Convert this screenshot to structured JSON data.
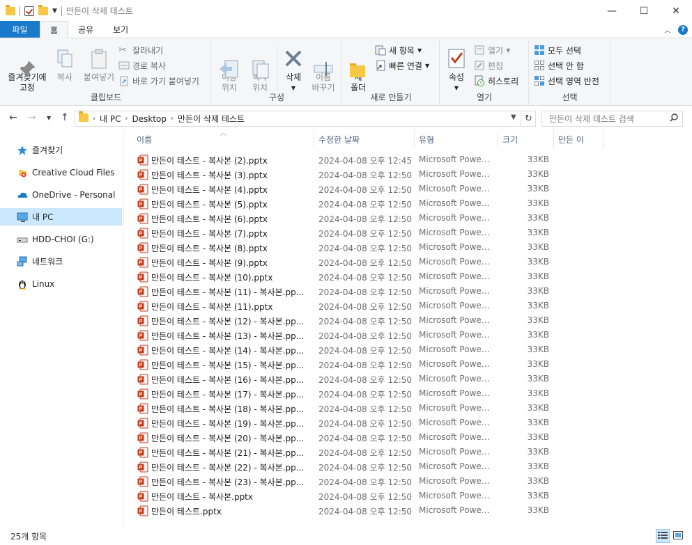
{
  "window": {
    "title": "만든이 삭제 테스트",
    "controls": {
      "minimize": "—",
      "maximize": "☐",
      "close": "✕"
    }
  },
  "ribbon_tabs": [
    "파일",
    "홈",
    "공유",
    "보기"
  ],
  "ribbon": {
    "clipboard": {
      "label": "클립보드",
      "pin": "즐겨찾기에\n고정",
      "copy": "복사",
      "paste": "붙여넣기",
      "cut": "잘라내기",
      "copy_path": "경로 복사",
      "paste_shortcut": "바로 가기 붙여넣기"
    },
    "organize": {
      "label": "구성",
      "move_to": "이동\n위치",
      "copy_to": "복사\n위치",
      "delete": "삭제",
      "rename": "이름\n바꾸기"
    },
    "new": {
      "label": "새로 만들기",
      "new_folder": "새\n폴더",
      "new_item": "새 항목",
      "easy_access": "빠른 연결"
    },
    "open": {
      "label": "열기",
      "properties": "속성",
      "open": "열기",
      "edit": "편집",
      "history": "히스토리"
    },
    "select": {
      "label": "선택",
      "select_all": "모두 선택",
      "select_none": "선택 안 함",
      "invert": "선택 영역 반전"
    }
  },
  "address": {
    "crumbs": [
      "내 PC",
      "Desktop",
      "만든이 삭제 테스트"
    ],
    "search_placeholder": "만든이 삭제 테스트 검색"
  },
  "navpane": {
    "items": [
      {
        "label": "즐겨찾기",
        "icon": "star-icon"
      },
      {
        "label": "Creative Cloud Files",
        "icon": "creative-cloud-icon"
      },
      {
        "label": "OneDrive - Personal",
        "icon": "onedrive-icon"
      },
      {
        "label": "내 PC",
        "icon": "pc-icon",
        "selected": true
      },
      {
        "label": "HDD-CHOI (G:)",
        "icon": "drive-icon"
      },
      {
        "label": "네트워크",
        "icon": "network-icon"
      },
      {
        "label": "Linux",
        "icon": "linux-icon"
      }
    ]
  },
  "columns": [
    "이름",
    "수정한 날짜",
    "유형",
    "크기",
    "만든 이"
  ],
  "files": [
    {
      "name": "만든이 테스트 - 복사본 (2).pptx",
      "date": "2024-04-08 오후 12:45",
      "type": "Microsoft PowerP...",
      "size": "33KB"
    },
    {
      "name": "만든이 테스트 - 복사본 (3).pptx",
      "date": "2024-04-08 오후 12:50",
      "type": "Microsoft PowerP...",
      "size": "33KB"
    },
    {
      "name": "만든이 테스트 - 복사본 (4).pptx",
      "date": "2024-04-08 오후 12:50",
      "type": "Microsoft PowerP...",
      "size": "33KB"
    },
    {
      "name": "만든이 테스트 - 복사본 (5).pptx",
      "date": "2024-04-08 오후 12:50",
      "type": "Microsoft PowerP...",
      "size": "33KB"
    },
    {
      "name": "만든이 테스트 - 복사본 (6).pptx",
      "date": "2024-04-08 오후 12:50",
      "type": "Microsoft PowerP...",
      "size": "33KB"
    },
    {
      "name": "만든이 테스트 - 복사본 (7).pptx",
      "date": "2024-04-08 오후 12:50",
      "type": "Microsoft PowerP...",
      "size": "33KB"
    },
    {
      "name": "만든이 테스트 - 복사본 (8).pptx",
      "date": "2024-04-08 오후 12:50",
      "type": "Microsoft PowerP...",
      "size": "33KB"
    },
    {
      "name": "만든이 테스트 - 복사본 (9).pptx",
      "date": "2024-04-08 오후 12:50",
      "type": "Microsoft PowerP...",
      "size": "33KB"
    },
    {
      "name": "만든이 테스트 - 복사본 (10).pptx",
      "date": "2024-04-08 오후 12:50",
      "type": "Microsoft PowerP...",
      "size": "33KB"
    },
    {
      "name": "만든이 테스트 - 복사본 (11) - 복사본.pp...",
      "date": "2024-04-08 오후 12:50",
      "type": "Microsoft PowerP...",
      "size": "33KB"
    },
    {
      "name": "만든이 테스트 - 복사본 (11).pptx",
      "date": "2024-04-08 오후 12:50",
      "type": "Microsoft PowerP...",
      "size": "33KB"
    },
    {
      "name": "만든이 테스트 - 복사본 (12) - 복사본.pp...",
      "date": "2024-04-08 오후 12:50",
      "type": "Microsoft PowerP...",
      "size": "33KB"
    },
    {
      "name": "만든이 테스트 - 복사본 (13) - 복사본.pp...",
      "date": "2024-04-08 오후 12:50",
      "type": "Microsoft PowerP...",
      "size": "33KB"
    },
    {
      "name": "만든이 테스트 - 복사본 (14) - 복사본.pp...",
      "date": "2024-04-08 오후 12:50",
      "type": "Microsoft PowerP...",
      "size": "33KB"
    },
    {
      "name": "만든이 테스트 - 복사본 (15) - 복사본.pp...",
      "date": "2024-04-08 오후 12:50",
      "type": "Microsoft PowerP...",
      "size": "33KB"
    },
    {
      "name": "만든이 테스트 - 복사본 (16) - 복사본.pp...",
      "date": "2024-04-08 오후 12:50",
      "type": "Microsoft PowerP...",
      "size": "33KB"
    },
    {
      "name": "만든이 테스트 - 복사본 (17) - 복사본.pp...",
      "date": "2024-04-08 오후 12:50",
      "type": "Microsoft PowerP...",
      "size": "33KB"
    },
    {
      "name": "만든이 테스트 - 복사본 (18) - 복사본.pp...",
      "date": "2024-04-08 오후 12:50",
      "type": "Microsoft PowerP...",
      "size": "33KB"
    },
    {
      "name": "만든이 테스트 - 복사본 (19) - 복사본.pp...",
      "date": "2024-04-08 오후 12:50",
      "type": "Microsoft PowerP...",
      "size": "33KB"
    },
    {
      "name": "만든이 테스트 - 복사본 (20) - 복사본.pp...",
      "date": "2024-04-08 오후 12:50",
      "type": "Microsoft PowerP...",
      "size": "33KB"
    },
    {
      "name": "만든이 테스트 - 복사본 (21) - 복사본.pp...",
      "date": "2024-04-08 오후 12:50",
      "type": "Microsoft PowerP...",
      "size": "33KB"
    },
    {
      "name": "만든이 테스트 - 복사본 (22) - 복사본.pp...",
      "date": "2024-04-08 오후 12:50",
      "type": "Microsoft PowerP...",
      "size": "33KB"
    },
    {
      "name": "만든이 테스트 - 복사본 (23) - 복사본.pp...",
      "date": "2024-04-08 오후 12:50",
      "type": "Microsoft PowerP...",
      "size": "33KB"
    },
    {
      "name": "만든이 테스트 - 복사본.pptx",
      "date": "2024-04-08 오후 12:50",
      "type": "Microsoft PowerP...",
      "size": "33KB"
    },
    {
      "name": "만든이 테스트.pptx",
      "date": "2024-04-08 오후 12:50",
      "type": "Microsoft PowerP...",
      "size": "33KB"
    }
  ],
  "status": {
    "count": "25개 항목"
  },
  "colors": {
    "accent": "#1979ca",
    "selection": "#cce8ff",
    "ppt": "#c43e1c",
    "folder": "#f7c843"
  }
}
